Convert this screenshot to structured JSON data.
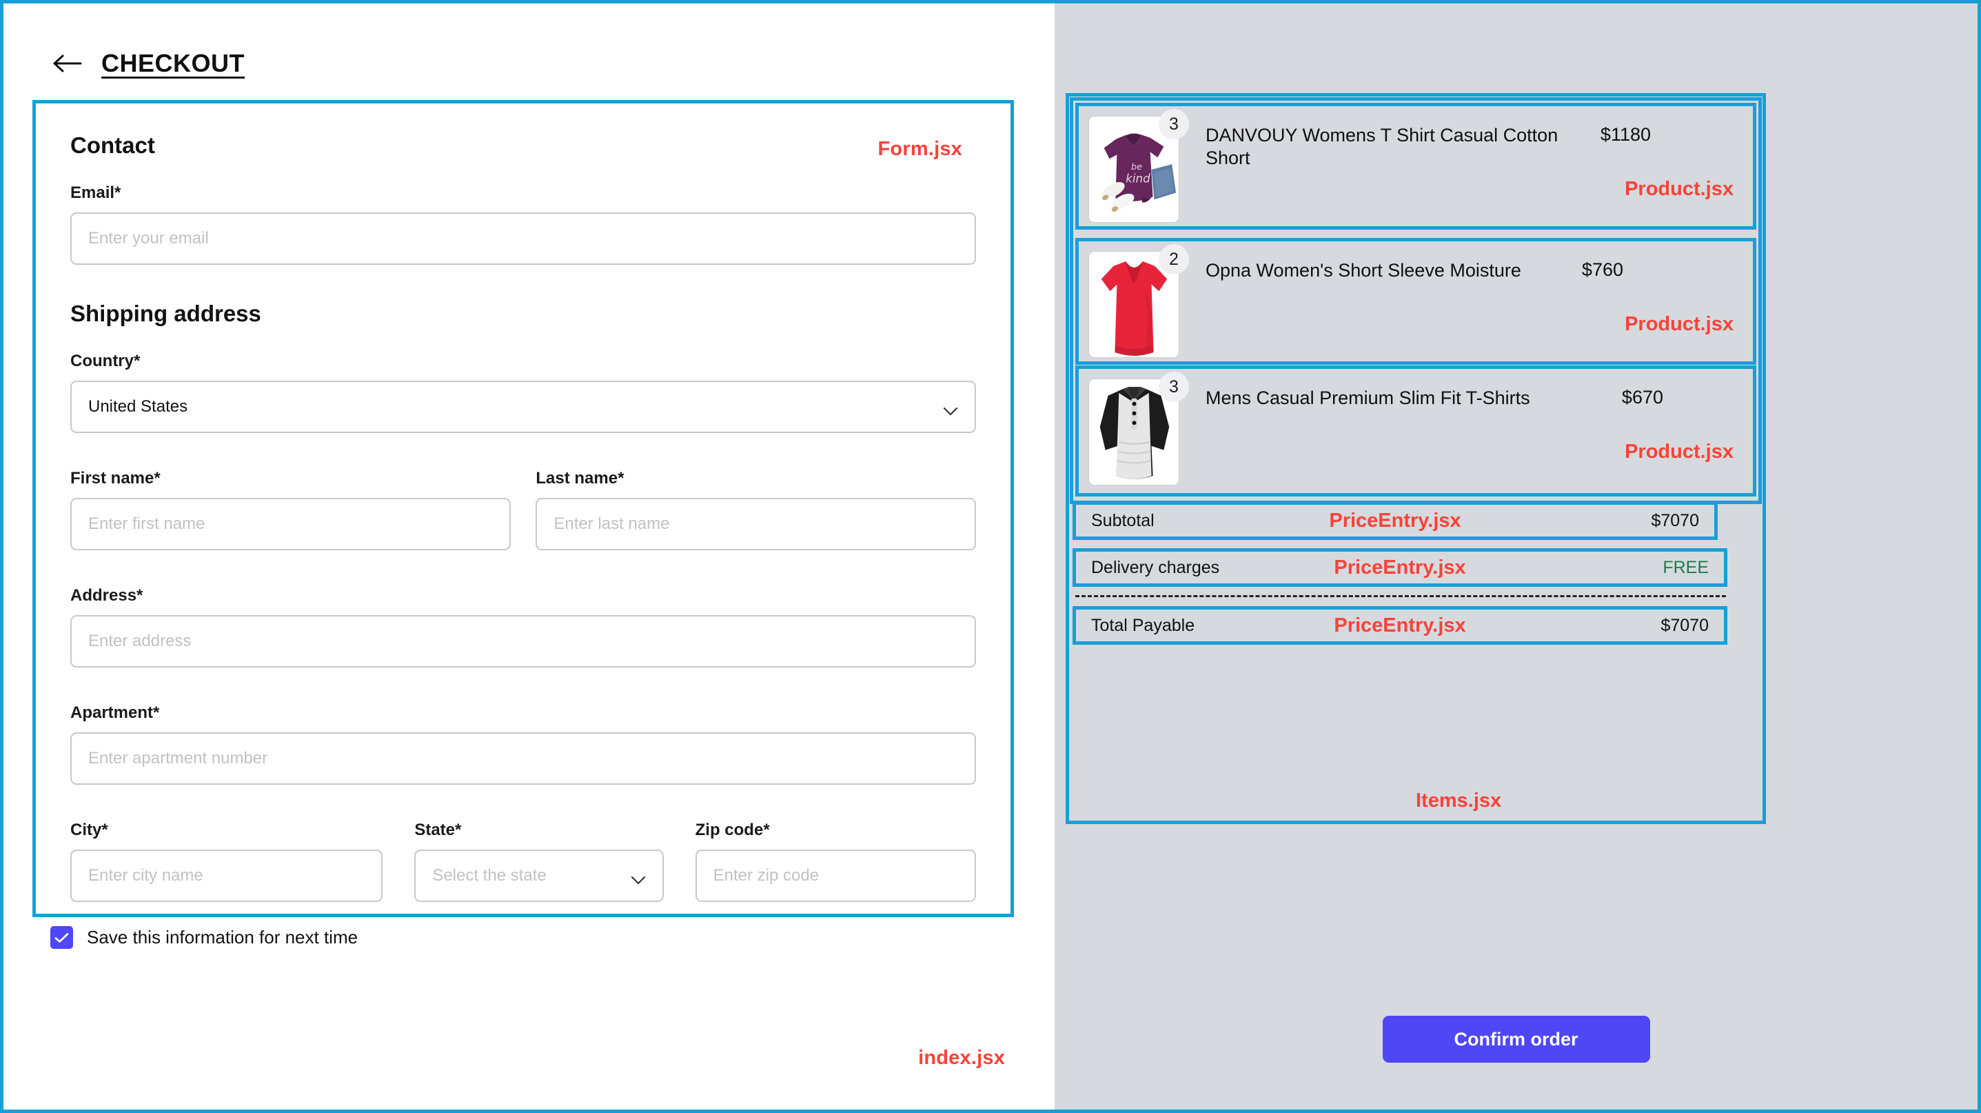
{
  "header": {
    "title": "CHECKOUT",
    "back_icon": "arrow-left-icon"
  },
  "annotations": {
    "form": "Form.jsx",
    "index": "index.jsx",
    "items": "Items.jsx",
    "product": "Product.jsx",
    "price_entry": "PriceEntry.jsx",
    "color": "#f8423a",
    "outline_color": "#189fd8"
  },
  "form": {
    "contact_heading": "Contact",
    "email_label": "Email*",
    "email_placeholder": "Enter your email",
    "email_value": "",
    "shipping_heading": "Shipping address",
    "country_label": "Country*",
    "country_value": "United States",
    "country_icon": "chevron-down-icon",
    "first_name_label": "First name*",
    "first_name_placeholder": "Enter first name",
    "first_name_value": "",
    "last_name_label": "Last name*",
    "last_name_placeholder": "Enter last name",
    "last_name_value": "",
    "address_label": "Address*",
    "address_placeholder": "Enter address",
    "address_value": "",
    "apartment_label": "Apartment*",
    "apartment_placeholder": "Enter apartment number",
    "apartment_value": "",
    "city_label": "City*",
    "city_placeholder": "Enter city name",
    "city_value": "",
    "state_label": "State*",
    "state_placeholder": "Select the state",
    "state_icon": "chevron-down-icon",
    "zip_label": "Zip code*",
    "zip_placeholder": "Enter zip code",
    "zip_value": "",
    "save_info_label": "Save this information for next time",
    "save_info_checked": true,
    "checkbox_icon": "check-icon",
    "checkbox_color": "#4f46f5"
  },
  "summary": {
    "products": [
      {
        "name": "DANVOUY Womens T Shirt Casual Cotton Short",
        "price": "$1180",
        "qty": "3",
        "image": "purple-tshirt-thumbnail"
      },
      {
        "name": "Opna Women's Short Sleeve Moisture",
        "price": "$760",
        "qty": "2",
        "image": "red-tshirt-thumbnail"
      },
      {
        "name": "Mens Casual Premium Slim Fit T-Shirts",
        "price": "$670",
        "qty": "3",
        "image": "grey-raglan-tshirt-thumbnail"
      }
    ],
    "price_rows": [
      {
        "label": "Subtotal",
        "value": "$7070",
        "free": false
      },
      {
        "label": "Delivery charges",
        "value": "FREE",
        "free": true
      },
      {
        "label": "Total Payable",
        "value": "$7070",
        "free": false
      }
    ],
    "confirm_label": "Confirm order",
    "confirm_color": "#4f46f5",
    "free_color": "#1f7a4d"
  }
}
